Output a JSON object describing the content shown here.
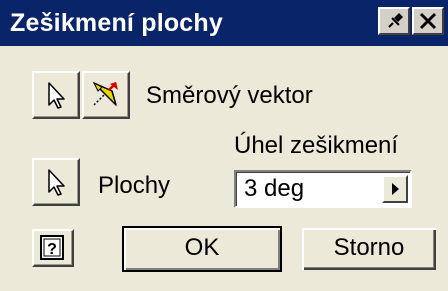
{
  "window": {
    "title": "Zešikmení plochy"
  },
  "direction": {
    "label": "Směrový vektor"
  },
  "faces": {
    "label": "Plochy"
  },
  "angle": {
    "label": "Úhel zešikmení",
    "value": "3 deg"
  },
  "buttons": {
    "ok": "OK",
    "cancel": "Storno"
  },
  "colors": {
    "titlebar": "#0a246a",
    "face": "#ece9d8",
    "flip_arrow": "#e8d800",
    "flip_arrow_tip": "#d40000"
  },
  "icons": {
    "select": "arrow-cursor-icon",
    "flip": "flip-direction-icon",
    "help": "help-icon",
    "pin": "pin-icon",
    "close": "close-icon",
    "dropdown": "right-arrow-icon"
  }
}
